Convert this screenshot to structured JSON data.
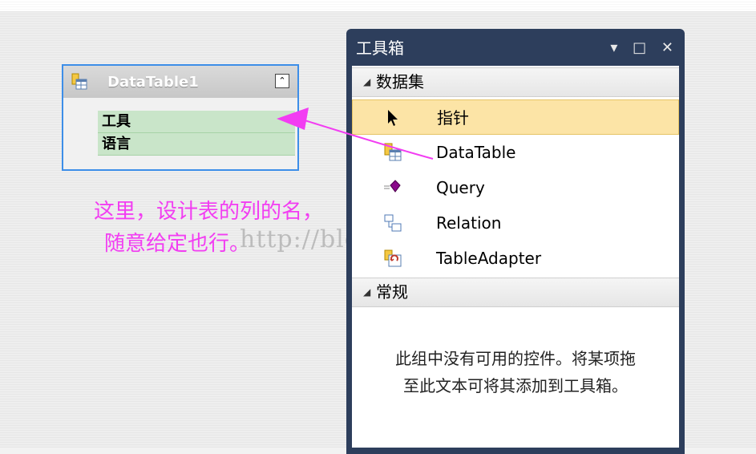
{
  "datatable": {
    "title": "DataTable1",
    "collapse_glyph": "⌃",
    "columns": [
      "工具",
      "语言"
    ]
  },
  "annotation": {
    "line1": "这里，设计表的列的名，",
    "line2": "随意给定也行。",
    "color": "#f23df2"
  },
  "watermark": "http://blog.csdn.net/",
  "toolbox": {
    "title": "工具箱",
    "buttons": {
      "menu": "▾",
      "maximize": "□",
      "close": "✕"
    },
    "categories": [
      {
        "label": "数据集",
        "items": [
          {
            "label": "指针",
            "icon": "pointer-icon",
            "selected": true
          },
          {
            "label": "DataTable",
            "icon": "datatable-icon"
          },
          {
            "label": "Query",
            "icon": "query-icon"
          },
          {
            "label": "Relation",
            "icon": "relation-icon"
          },
          {
            "label": "TableAdapter",
            "icon": "tableadapter-icon"
          }
        ]
      },
      {
        "label": "常规",
        "empty_line1": "此组中没有可用的控件。将某项拖",
        "empty_line2": "至此文本可将其添加到工具箱。"
      }
    ],
    "colors": {
      "frame": "#2d3e5c",
      "selected": "#fce4a6"
    }
  }
}
